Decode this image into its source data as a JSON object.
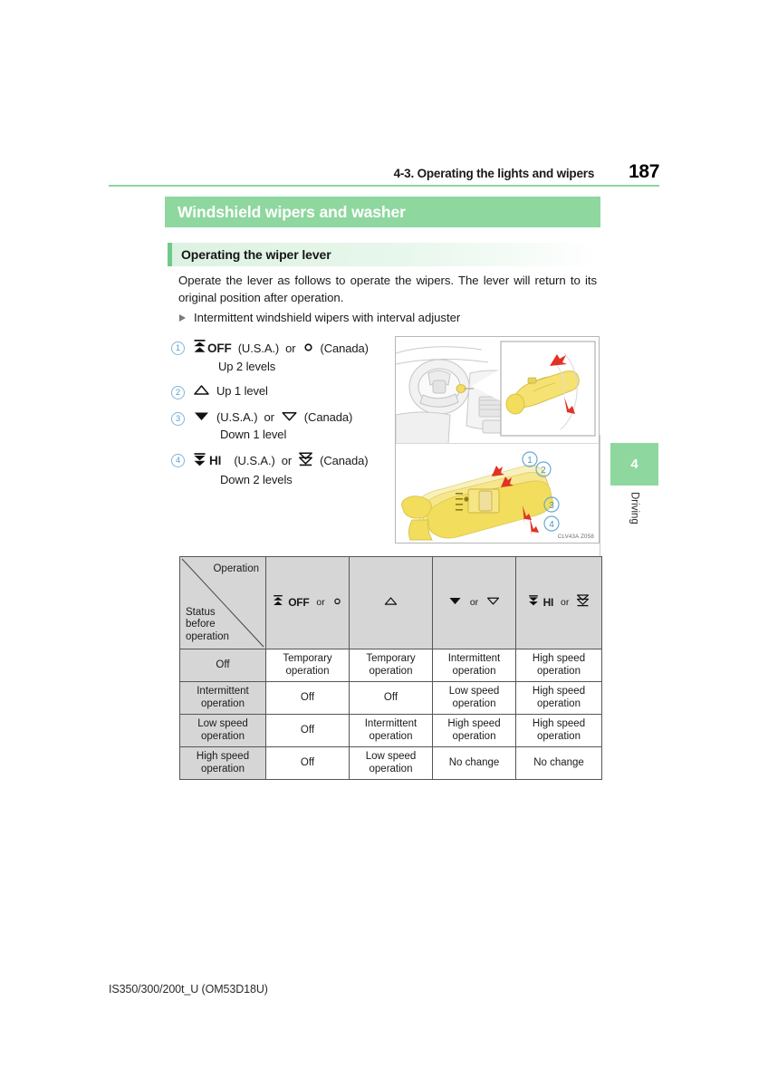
{
  "runhead": {
    "section": "4-3. Operating the lights and wipers",
    "page_number": "187"
  },
  "title": "Windshield wipers and washer",
  "subheading": "Operating the wiper lever",
  "paragraph": "Operate the lever as follows to operate the wipers. The lever will return to its original position after operation.",
  "bullet": "Intermittent windshield wipers with interval adjuster",
  "lever_items": [
    {
      "number": "1",
      "icon": "wiper-off-double-up-icon",
      "label": "OFF",
      "usa": "(U.S.A.)",
      "or": "or",
      "alt_icon": "circle-o-icon",
      "canada": "(Canada)",
      "detail": "Up 2 levels"
    },
    {
      "number": "2",
      "icon": "triangle-up-outline-icon",
      "label": "",
      "usa": "",
      "or": "",
      "alt_icon": "",
      "canada": "",
      "detail": "Up 1 level",
      "inline_detail": true
    },
    {
      "number": "3",
      "icon": "triangle-down-filled-icon",
      "label": "",
      "usa": "(U.S.A.)",
      "or": "or",
      "alt_icon": "triangle-down-outline-icon",
      "canada": "(Canada)",
      "detail": "Down 1 level"
    },
    {
      "number": "4",
      "icon": "wiper-hi-double-down-icon",
      "label": "HI",
      "usa": "(U.S.A.)",
      "or": "or",
      "alt_icon": "double-chevron-down-outline-icon",
      "canada": "(Canada)",
      "detail": "Down 2 levels"
    }
  ],
  "figure": {
    "code": "CLV43A Z058",
    "callouts": [
      "1",
      "2",
      "3",
      "4"
    ],
    "alt": "Illustration of steering column wiper lever positions"
  },
  "side_tab": {
    "chapter": "4",
    "label": "Driving"
  },
  "table": {
    "corner_col_label": "Operation",
    "corner_row_label": "Status\nbefore\noperation",
    "corner_row_lines": [
      "Status",
      "before",
      "operation"
    ],
    "or_text": "or",
    "columns": [
      {
        "icon": "wiper-off-double-up-icon",
        "label": "OFF",
        "alt_icon": "circle-o-icon",
        "has_or": true
      },
      {
        "icon": "triangle-up-outline-icon",
        "label": "",
        "alt_icon": "",
        "has_or": false
      },
      {
        "icon": "triangle-down-filled-icon",
        "label": "",
        "alt_icon": "triangle-down-outline-icon",
        "has_or": true
      },
      {
        "icon": "wiper-hi-double-down-icon",
        "label": "HI",
        "alt_icon": "double-chevron-down-outline-icon",
        "has_or": true
      }
    ],
    "rows": [
      {
        "status": "Off",
        "cells": [
          "Temporary operation",
          "Temporary operation",
          "Intermittent operation",
          "High speed operation"
        ]
      },
      {
        "status": "Intermittent operation",
        "cells": [
          "Off",
          "Off",
          "Low speed operation",
          "High speed operation"
        ]
      },
      {
        "status": "Low speed operation",
        "cells": [
          "Off",
          "Intermittent operation",
          "High speed operation",
          "High speed operation"
        ]
      },
      {
        "status": "High speed operation",
        "cells": [
          "Off",
          "Low speed operation",
          "No change",
          "No change"
        ]
      }
    ]
  },
  "footer": "IS350/300/200t_U (OM53D18U)",
  "colors": {
    "accent_green": "#8ed79e",
    "subhead_bar": "#6fc98a",
    "callout_blue": "#5a9ecb",
    "table_header_gray": "#d6d6d6",
    "lever_yellow": "#f2dd5c",
    "arrow_red": "#e03324"
  }
}
